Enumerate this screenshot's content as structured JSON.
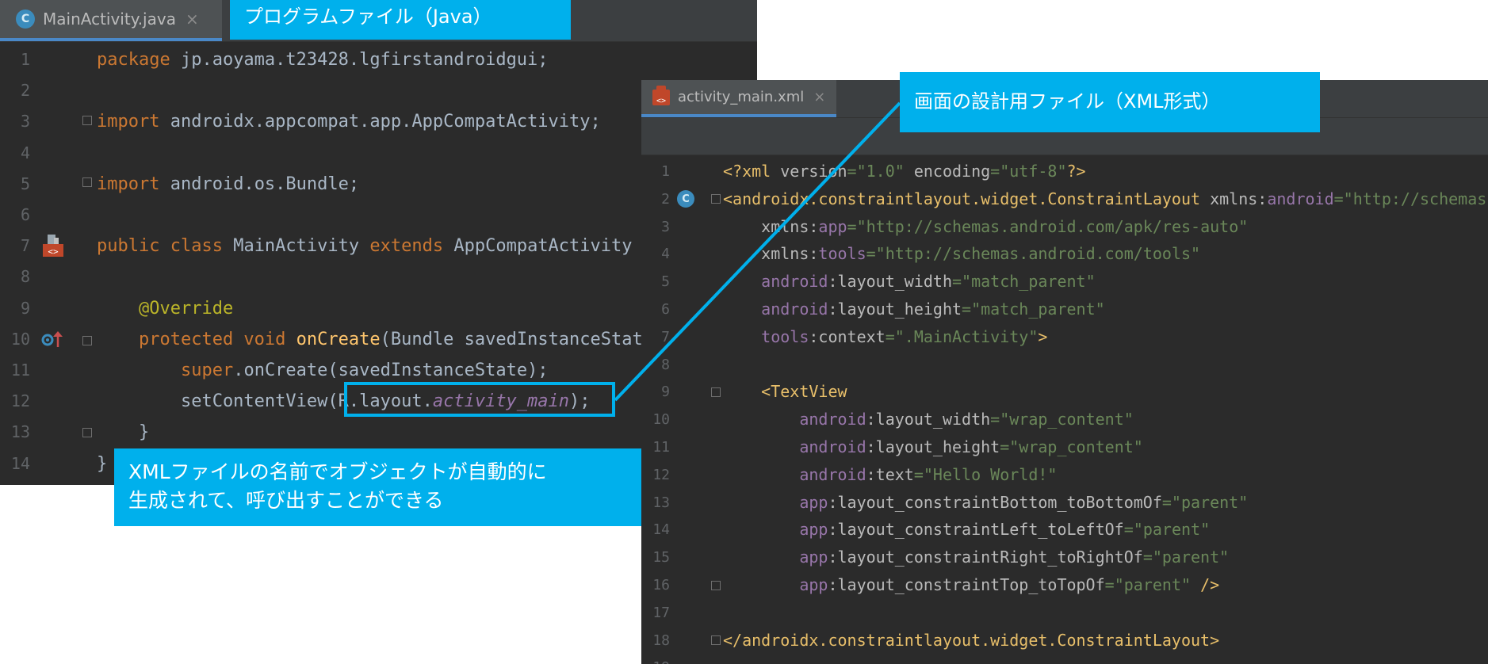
{
  "java_editor": {
    "tab": {
      "icon": "class-icon",
      "icon_letter": "C",
      "filename": "MainActivity.java",
      "close": "×"
    },
    "lines": [
      {
        "n": "1",
        "html": "<span class='kw'>package</span> jp.aoyama.t23428.lgfirstandroidgui;"
      },
      {
        "n": "2",
        "html": ""
      },
      {
        "n": "3",
        "html": "<span class='kw'>import</span> androidx.appcompat.app.AppCompatActivity;"
      },
      {
        "n": "4",
        "html": ""
      },
      {
        "n": "5",
        "html": "<span class='kw'>import</span> android.os.Bundle;"
      },
      {
        "n": "6",
        "html": ""
      },
      {
        "n": "7",
        "html": "<span class='kw'>public class</span> MainActivity <span class='kw'>extends</span> AppCompatActivity {"
      },
      {
        "n": "8",
        "html": ""
      },
      {
        "n": "9",
        "html": "    <span class='ann'>@Override</span>"
      },
      {
        "n": "10",
        "html": "    <span class='kw'>protected void</span> <span class='fn'>onCreate</span>(Bundle savedInstanceState) {"
      },
      {
        "n": "11",
        "html": "        <span class='kw'>super</span>.onCreate(savedInstanceState);"
      },
      {
        "n": "12",
        "html": "        setContentView(R.layout.<span class='it'>activity_main</span>);"
      },
      {
        "n": "13",
        "html": "    }"
      },
      {
        "n": "14",
        "html": "}"
      }
    ]
  },
  "xml_editor": {
    "tab": {
      "icon": "xml-file-icon",
      "icon_label": "<>",
      "filename": "activity_main.xml",
      "close": "×"
    },
    "lines": [
      {
        "n": "1",
        "html": "<span class='tag'>&lt;?xml </span><span class='attr'>version</span><span class='str'>=\"1.0\"</span> <span class='attr'>encoding</span><span class='str'>=\"utf-8\"</span><span class='tag'>?&gt;</span>"
      },
      {
        "n": "2",
        "html": "<span class='tag'>&lt;androidx.constraintlayout.widget.ConstraintLayout </span><span class='attr'>xmlns:</span><span class='ns'>android</span><span class='str'>=\"http://schemas.android.com/apk/res/android\"</span>"
      },
      {
        "n": "3",
        "html": "    <span class='attr'>xmlns:</span><span class='ns'>app</span><span class='str'>=\"http://schemas.android.com/apk/res-auto\"</span>"
      },
      {
        "n": "4",
        "html": "    <span class='attr'>xmlns:</span><span class='ns'>tools</span><span class='str'>=\"http://schemas.android.com/tools\"</span>"
      },
      {
        "n": "5",
        "html": "    <span class='ns'>android</span><span class='attr'>:layout_width</span><span class='str'>=\"match_parent\"</span>"
      },
      {
        "n": "6",
        "html": "    <span class='ns'>android</span><span class='attr'>:layout_height</span><span class='str'>=\"match_parent\"</span>"
      },
      {
        "n": "7",
        "html": "    <span class='ns'>tools</span><span class='attr'>:context</span><span class='str'>=\".MainActivity\"</span><span class='tag'>&gt;</span>"
      },
      {
        "n": "8",
        "html": ""
      },
      {
        "n": "9",
        "html": "    <span class='tag'>&lt;TextView</span>"
      },
      {
        "n": "10",
        "html": "        <span class='ns'>android</span><span class='attr'>:layout_width</span><span class='str'>=\"wrap_content\"</span>"
      },
      {
        "n": "11",
        "html": "        <span class='ns'>android</span><span class='attr'>:layout_height</span><span class='str'>=\"wrap_content\"</span>"
      },
      {
        "n": "12",
        "html": "        <span class='ns'>android</span><span class='attr'>:text</span><span class='str'>=\"Hello World!\"</span>"
      },
      {
        "n": "13",
        "html": "        <span class='ns'>app</span><span class='attr'>:layout_constraintBottom_toBottomOf</span><span class='str'>=\"parent\"</span>"
      },
      {
        "n": "14",
        "html": "        <span class='ns'>app</span><span class='attr'>:layout_constraintLeft_toLeftOf</span><span class='str'>=\"parent\"</span>"
      },
      {
        "n": "15",
        "html": "        <span class='ns'>app</span><span class='attr'>:layout_constraintRight_toRightOf</span><span class='str'>=\"parent\"</span>"
      },
      {
        "n": "16",
        "html": "        <span class='ns'>app</span><span class='attr'>:layout_constraintTop_toTopOf</span><span class='str'>=\"parent\"</span> <span class='tag'>/&gt;</span>"
      },
      {
        "n": "17",
        "html": ""
      },
      {
        "n": "18",
        "html": "<span class='tag'>&lt;/androidx.constraintlayout.widget.ConstraintLayout&gt;</span>"
      },
      {
        "n": "19",
        "html": ""
      }
    ]
  },
  "callouts": {
    "java_file": "プログラムファイル（Java）",
    "xml_file": "画面の設計用ファイル（XML形式）",
    "explanation_line1": "XMLファイルの名前でオブジェクトが自動的に",
    "explanation_line2": "生成されて、呼び出すことができる"
  },
  "colors": {
    "accent": "#00b0ec",
    "editor_bg": "#2b2b2b",
    "keyword": "#cc7832",
    "string": "#6a8759",
    "tag": "#e8bf6a"
  }
}
